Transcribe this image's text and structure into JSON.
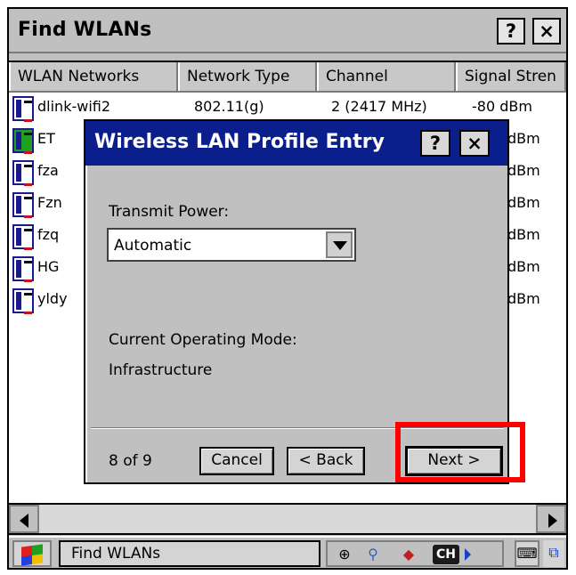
{
  "window": {
    "title": "Find WLANs",
    "help_label": "?",
    "close_label": "×"
  },
  "list": {
    "columns": [
      "WLAN Networks",
      "Network Type",
      "Channel",
      "Signal Stren"
    ],
    "rows": [
      {
        "ssid": "dlink-wifi2",
        "type": "802.11(g)",
        "channel": "2 (2417 MHz)",
        "signal": "-80 dBm"
      },
      {
        "ssid": "ET",
        "type": "",
        "channel": "",
        "signal": "dBm"
      },
      {
        "ssid": "fza",
        "type": "",
        "channel": "",
        "signal": "dBm"
      },
      {
        "ssid": "Fzn",
        "type": "",
        "channel": "",
        "signal": "dBm"
      },
      {
        "ssid": "fzq",
        "type": "",
        "channel": "",
        "signal": "dBm"
      },
      {
        "ssid": "HG",
        "type": "",
        "channel": "",
        "signal": "dBm"
      },
      {
        "ssid": "yldy",
        "type": "",
        "channel": "",
        "signal": "dBm"
      }
    ]
  },
  "dialog": {
    "title": "Wireless LAN Profile Entry",
    "help_label": "?",
    "close_label": "×",
    "transmit_power_label": "Transmit Power:",
    "transmit_power_value": "Automatic",
    "operating_mode_label": "Current Operating Mode:",
    "operating_mode_value": "Infrastructure",
    "page_indicator": "8 of 9",
    "cancel_label": "Cancel",
    "back_label": "< Back",
    "next_label": "Next >"
  },
  "taskbar": {
    "task_label": "Find WLANs",
    "input_lang": "CH"
  },
  "colors": {
    "dialog_title_bg": "#0a1e8c",
    "highlight": "#ff0000"
  }
}
